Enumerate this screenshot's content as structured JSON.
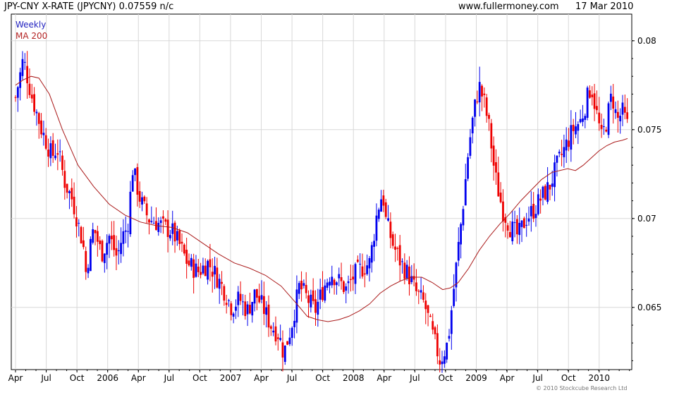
{
  "header": {
    "title": "JPY-CNY X-RATE (JPYCNY) 0.07559 n/c",
    "website": "www.fullermoney.com",
    "date": "17 Mar 2010"
  },
  "legend": {
    "weekly": "Weekly",
    "ma": "MA 200"
  },
  "footer": {
    "copyright": "© 2010 Stockcube Research Ltd"
  },
  "colors": {
    "up": "#0000ee",
    "down": "#ee0000",
    "ma": "#aa1a1a",
    "grid": "#d8d8d8"
  },
  "chart_data": {
    "type": "candlestick",
    "y_ticks": [
      0.065,
      0.07,
      0.075,
      0.08
    ],
    "y_tick_labels": [
      "0.065",
      "0.07",
      "0.075",
      "0.08"
    ],
    "ylim": [
      0.0615,
      0.0815
    ],
    "x_ticks": [
      "Apr",
      "Jul",
      "Oct",
      "2006",
      "Apr",
      "Jul",
      "Oct",
      "2007",
      "Apr",
      "Jul",
      "Oct",
      "2008",
      "Apr",
      "Jul",
      "Oct",
      "2009",
      "Apr",
      "Jul",
      "Oct",
      "2010"
    ],
    "x_tick_weeks": [
      0,
      13,
      26,
      39,
      52,
      65,
      78,
      91,
      104,
      117,
      130,
      143,
      156,
      169,
      182,
      195,
      208,
      221,
      234,
      247
    ],
    "week_count": 260,
    "grid": true,
    "series": [
      {
        "name": "Weekly",
        "kind": "candles",
        "anchors": [
          [
            0,
            0.0768
          ],
          [
            3,
            0.079
          ],
          [
            6,
            0.077
          ],
          [
            10,
            0.075
          ],
          [
            14,
            0.0735
          ],
          [
            16,
            0.074
          ],
          [
            19,
            0.072
          ],
          [
            22,
            0.071
          ],
          [
            26,
            0.0685
          ],
          [
            27,
            0.067
          ],
          [
            30,
            0.0695
          ],
          [
            33,
            0.068
          ],
          [
            36,
            0.069
          ],
          [
            39,
            0.0678
          ],
          [
            41,
            0.069
          ],
          [
            43,
            0.0695
          ],
          [
            45,
            0.0728
          ],
          [
            48,
            0.071
          ],
          [
            51,
            0.07
          ],
          [
            54,
            0.0698
          ],
          [
            57,
            0.0695
          ],
          [
            60,
            0.0693
          ],
          [
            63,
            0.0685
          ],
          [
            66,
            0.0675
          ],
          [
            70,
            0.067
          ],
          [
            74,
            0.0675
          ],
          [
            77,
            0.0668
          ],
          [
            80,
            0.066
          ],
          [
            83,
            0.065
          ],
          [
            86,
            0.0655
          ],
          [
            89,
            0.0648
          ],
          [
            92,
            0.0658
          ],
          [
            95,
            0.065
          ],
          [
            98,
            0.064
          ],
          [
            101,
            0.0635
          ],
          [
            103,
            0.0624
          ],
          [
            106,
            0.064
          ],
          [
            109,
            0.0662
          ],
          [
            112,
            0.0655
          ],
          [
            115,
            0.0648
          ],
          [
            118,
            0.066
          ],
          [
            121,
            0.067
          ],
          [
            124,
            0.0665
          ],
          [
            127,
            0.066
          ],
          [
            130,
            0.0668
          ],
          [
            133,
            0.0672
          ],
          [
            136,
            0.0675
          ],
          [
            139,
            0.0705
          ],
          [
            141,
            0.0715
          ],
          [
            142,
            0.07
          ],
          [
            145,
            0.0685
          ],
          [
            148,
            0.0675
          ],
          [
            151,
            0.0668
          ],
          [
            154,
            0.0658
          ],
          [
            157,
            0.0652
          ],
          [
            160,
            0.0635
          ],
          [
            163,
            0.062
          ],
          [
            166,
            0.063
          ],
          [
            169,
            0.067
          ],
          [
            172,
            0.071
          ],
          [
            174,
            0.074
          ],
          [
            176,
            0.076
          ],
          [
            178,
            0.0775
          ],
          [
            180,
            0.0765
          ],
          [
            182,
            0.075
          ],
          [
            184,
            0.0725
          ],
          [
            187,
            0.0705
          ],
          [
            190,
            0.0695
          ],
          [
            193,
            0.069
          ],
          [
            196,
            0.07
          ],
          [
            199,
            0.0705
          ],
          [
            202,
            0.0712
          ],
          [
            205,
            0.0718
          ],
          [
            208,
            0.073
          ],
          [
            211,
            0.074
          ],
          [
            214,
            0.075
          ],
          [
            217,
            0.0755
          ],
          [
            219,
            0.0765
          ],
          [
            221,
            0.0775
          ],
          [
            223,
            0.076
          ],
          [
            225,
            0.0745
          ],
          [
            227,
            0.0755
          ],
          [
            229,
            0.077
          ],
          [
            231,
            0.0755
          ],
          [
            233,
            0.076
          ],
          [
            235,
            0.0752
          ]
        ]
      },
      {
        "name": "MA 200",
        "kind": "line",
        "points": [
          [
            0,
            0.0775
          ],
          [
            3,
            0.0778
          ],
          [
            6,
            0.078
          ],
          [
            9,
            0.0779
          ],
          [
            13,
            0.077
          ],
          [
            18,
            0.075
          ],
          [
            24,
            0.073
          ],
          [
            30,
            0.0718
          ],
          [
            36,
            0.0708
          ],
          [
            42,
            0.0702
          ],
          [
            48,
            0.0698
          ],
          [
            54,
            0.0696
          ],
          [
            60,
            0.0695
          ],
          [
            66,
            0.0692
          ],
          [
            72,
            0.0686
          ],
          [
            78,
            0.068
          ],
          [
            84,
            0.0675
          ],
          [
            90,
            0.0672
          ],
          [
            96,
            0.0668
          ],
          [
            102,
            0.0662
          ],
          [
            108,
            0.0652
          ],
          [
            112,
            0.0645
          ],
          [
            116,
            0.0643
          ],
          [
            120,
            0.0642
          ],
          [
            124,
            0.0643
          ],
          [
            128,
            0.0645
          ],
          [
            132,
            0.0648
          ],
          [
            136,
            0.0652
          ],
          [
            140,
            0.0658
          ],
          [
            144,
            0.0662
          ],
          [
            148,
            0.0665
          ],
          [
            152,
            0.0667
          ],
          [
            156,
            0.0667
          ],
          [
            160,
            0.0664
          ],
          [
            164,
            0.066
          ],
          [
            167,
            0.0661
          ],
          [
            170,
            0.0664
          ],
          [
            174,
            0.0672
          ],
          [
            178,
            0.0682
          ],
          [
            182,
            0.069
          ],
          [
            186,
            0.0697
          ],
          [
            190,
            0.0703
          ],
          [
            194,
            0.071
          ],
          [
            198,
            0.0716
          ],
          [
            202,
            0.0722
          ],
          [
            206,
            0.0726
          ],
          [
            209,
            0.0727
          ],
          [
            212,
            0.0728
          ],
          [
            215,
            0.0727
          ],
          [
            218,
            0.073
          ],
          [
            221,
            0.0734
          ],
          [
            224,
            0.0738
          ],
          [
            227,
            0.0741
          ],
          [
            230,
            0.0743
          ],
          [
            233,
            0.0744
          ],
          [
            235,
            0.0745
          ]
        ]
      }
    ]
  }
}
